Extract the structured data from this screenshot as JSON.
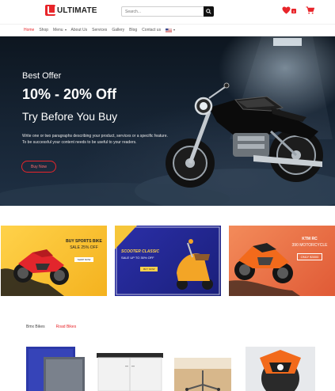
{
  "header": {
    "logo_text": "ULTIMATE",
    "search_placeholder": "Search...",
    "wishlist_count": "0"
  },
  "nav": {
    "items": [
      "Home",
      "Shop",
      "Menu",
      "About Us",
      "Services",
      "Gallery",
      "Blog",
      "Contact us"
    ]
  },
  "hero": {
    "offer_label": "Best Offer",
    "discount": "10% - 20% Off",
    "subtitle": "Try Before You Buy",
    "text_line1": "Write one or two paragraphs describing your product, services or a specific feature.",
    "text_line2": "To be successful your content needs to be useful to your readers.",
    "button_label": "Buy Now"
  },
  "promos": [
    {
      "title": "BUY SPORTS BIKE",
      "subtitle": "SALE 25% OFF",
      "button": "SHOP NOW"
    },
    {
      "title": "SCOOTER CLASSIC",
      "subtitle": "SALE UP TO 30% OFF",
      "button": "BUY NOW"
    },
    {
      "title": "KTM RC",
      "subtitle": "390 MOTORCYCLE",
      "price": "ONLY $3000"
    }
  ],
  "tabs": [
    "Bmx Bikes",
    "Road Bikes"
  ],
  "colors": {
    "accent": "#e8252a",
    "hero_bg": "#172535",
    "text": "#222222"
  }
}
